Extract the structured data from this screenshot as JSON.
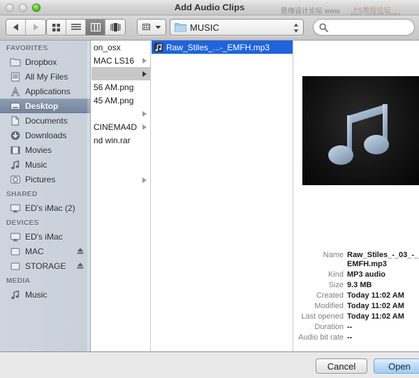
{
  "window": {
    "title": "Add Audio Clips",
    "traffic_lights": [
      "close-disabled",
      "minimize-disabled",
      "zoom-active"
    ]
  },
  "watermark": {
    "line1": "思缘设计论坛  www.",
    "line2": "PS教程论坛",
    "line3": "BBS.16XX8.COM"
  },
  "toolbar": {
    "back_label": "back-arrow",
    "forward_label": "forward-arrow",
    "views": [
      {
        "name": "icon-view",
        "selected": false
      },
      {
        "name": "list-view",
        "selected": false
      },
      {
        "name": "column-view",
        "selected": true
      },
      {
        "name": "coverflow-view",
        "selected": false
      }
    ],
    "action_label": "arrange-by",
    "path_label": "MUSIC",
    "search_placeholder": ""
  },
  "sidebar": {
    "sections": [
      {
        "title": "FAVORITES",
        "items": [
          {
            "label": "Dropbox",
            "icon": "folder-icon",
            "selected": false,
            "eject": false
          },
          {
            "label": "All My Files",
            "icon": "all-files-icon",
            "selected": false,
            "eject": false
          },
          {
            "label": "Applications",
            "icon": "applications-icon",
            "selected": false,
            "eject": false
          },
          {
            "label": "Desktop",
            "icon": "desktop-icon",
            "selected": true,
            "eject": false
          },
          {
            "label": "Documents",
            "icon": "documents-icon",
            "selected": false,
            "eject": false
          },
          {
            "label": "Downloads",
            "icon": "downloads-icon",
            "selected": false,
            "eject": false
          },
          {
            "label": "Movies",
            "icon": "movies-icon",
            "selected": false,
            "eject": false
          },
          {
            "label": "Music",
            "icon": "music-note-icon",
            "selected": false,
            "eject": false
          },
          {
            "label": "Pictures",
            "icon": "pictures-icon",
            "selected": false,
            "eject": false
          }
        ]
      },
      {
        "title": "SHARED",
        "items": [
          {
            "label": "ED's iMac (2)",
            "icon": "imac-icon",
            "selected": false,
            "eject": false
          }
        ]
      },
      {
        "title": "DEVICES",
        "items": [
          {
            "label": "ED's iMac",
            "icon": "imac-icon",
            "selected": false,
            "eject": false
          },
          {
            "label": "MAC",
            "icon": "drive-icon",
            "selected": false,
            "eject": true
          },
          {
            "label": "STORAGE",
            "icon": "drive-icon",
            "selected": false,
            "eject": true
          }
        ]
      },
      {
        "title": "MEDIA",
        "items": [
          {
            "label": "Music",
            "icon": "music-note-icon",
            "selected": false,
            "eject": false
          }
        ]
      }
    ]
  },
  "columns": {
    "column1": {
      "rows": [
        {
          "label": "on_osx",
          "arrow": false,
          "selected": "none"
        },
        {
          "label": "MAC LS16",
          "arrow": true,
          "selected": "none"
        },
        {
          "label": "",
          "arrow": true,
          "selected": "gray"
        },
        {
          "label": "56 AM.png",
          "arrow": false,
          "selected": "none"
        },
        {
          "label": "45 AM.png",
          "arrow": false,
          "selected": "none"
        },
        {
          "label": "",
          "arrow": true,
          "selected": "none"
        },
        {
          "label": "CINEMA4D",
          "arrow": true,
          "selected": "none"
        },
        {
          "label": "nd win.rar",
          "arrow": false,
          "selected": "none"
        },
        {
          "label": "",
          "arrow": false,
          "selected": "none"
        },
        {
          "label": "",
          "arrow": false,
          "selected": "none"
        },
        {
          "label": "",
          "arrow": true,
          "selected": "none"
        }
      ]
    },
    "column2": {
      "rows": [
        {
          "label": "Raw_Stiles_...-_EMFH.mp3",
          "icon": "mp3-file-icon",
          "selected": "blue"
        }
      ]
    }
  },
  "preview": {
    "artwork": "music-note-album-art",
    "metadata": [
      {
        "label": "Name",
        "value": "Raw_Stiles_-_03_-_EMFH.mp3"
      },
      {
        "label": "Kind",
        "value": "MP3 audio"
      },
      {
        "label": "Size",
        "value": "9.3 MB"
      },
      {
        "label": "Created",
        "value": "Today 11:02 AM"
      },
      {
        "label": "Modified",
        "value": "Today 11:02 AM"
      },
      {
        "label": "Last opened",
        "value": "Today 11:02 AM"
      },
      {
        "label": "Duration",
        "value": "--"
      },
      {
        "label": "Audio bit rate",
        "value": "--"
      }
    ]
  },
  "footer": {
    "cancel_label": "Cancel",
    "open_label": "Open"
  },
  "colors": {
    "selection_blue": "#1f64dc",
    "default_button_blue": "#a6cbf3",
    "sidebar_bg": "#ced5de"
  }
}
